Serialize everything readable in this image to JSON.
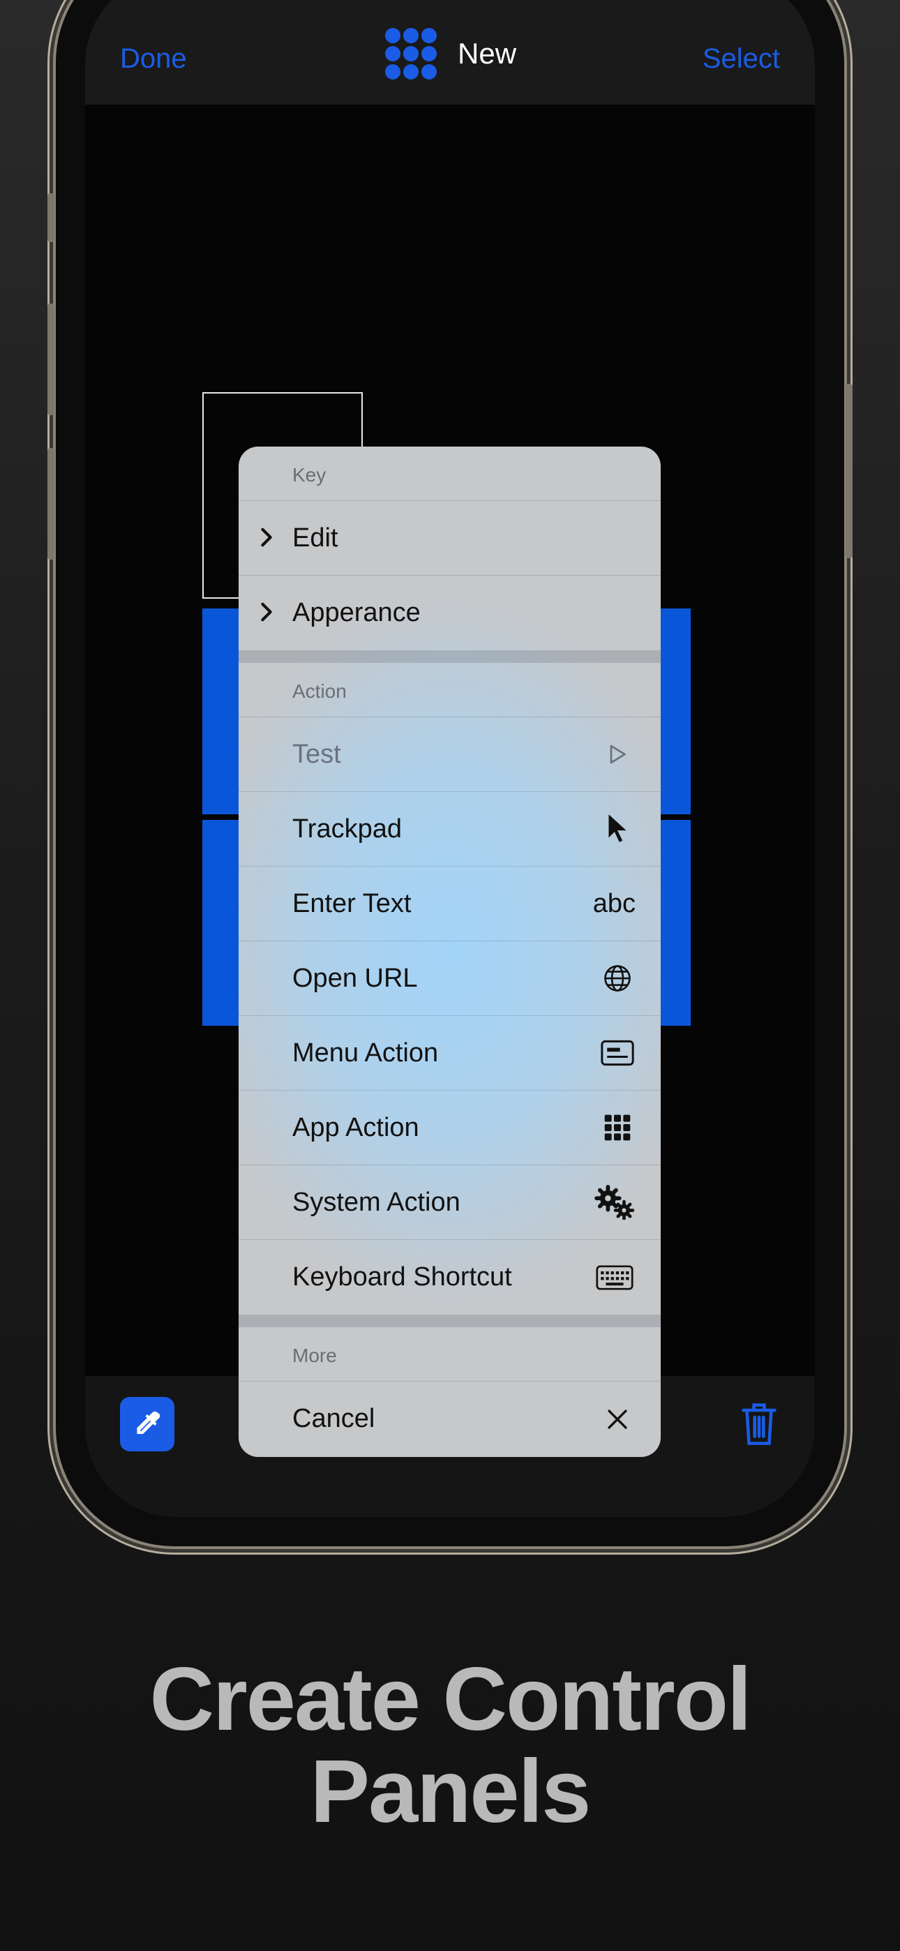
{
  "nav": {
    "done_label": "Done",
    "title": "New",
    "select_label": "Select",
    "accent_color": "#1a5ce6"
  },
  "menu": {
    "key_section": {
      "header": "Key",
      "items": [
        {
          "label": "Edit",
          "icon": "chevron-right-icon"
        },
        {
          "label": "Apperance",
          "icon": "chevron-right-icon"
        }
      ]
    },
    "action_section": {
      "header": "Action",
      "items": [
        {
          "label": "Test",
          "icon": "play-icon",
          "disabled": true
        },
        {
          "label": "Trackpad",
          "icon": "cursor-icon"
        },
        {
          "label": "Enter Text",
          "icon_text": "abc"
        },
        {
          "label": "Open URL",
          "icon": "globe-icon"
        },
        {
          "label": "Menu Action",
          "icon": "menu-icon"
        },
        {
          "label": "App Action",
          "icon": "grid-icon"
        },
        {
          "label": "System Action",
          "icon": "gears-icon"
        },
        {
          "label": "Keyboard Shortcut",
          "icon": "keyboard-icon"
        }
      ]
    },
    "more_section": {
      "header": "More",
      "items": [
        {
          "label": "Cancel",
          "icon": "close-icon"
        }
      ]
    }
  },
  "toolbar": {
    "left_icon": "eyedropper-icon",
    "right_icon": "trash-icon"
  },
  "caption": {
    "line1": "Create Control",
    "line2": "Panels"
  }
}
